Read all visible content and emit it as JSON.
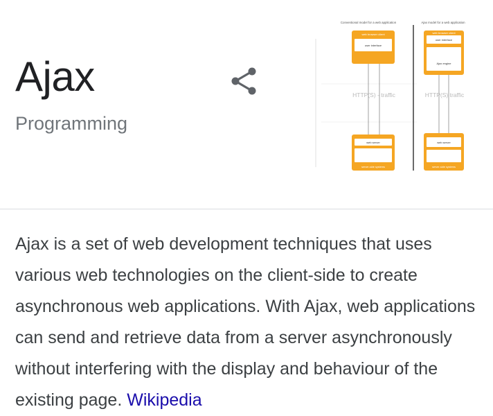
{
  "panel": {
    "title": "Ajax",
    "subtitle": "Programming",
    "description": "Ajax is a set of web development techniques that uses various web technologies on the client-side to create asynchronous web applications. With Ajax, web applications can send and retrieve data from a server asynchronously without interfering with the display and behaviour of the existing page.",
    "source_link": "Wikipedia",
    "share_icon": "share-icon"
  },
  "thumbnail": {
    "left_heading": "Conventional model for a web application",
    "right_heading": "Ajax model for a web application",
    "left_traffic": "HTTP(S) - traffic",
    "right_traffic": "HTTP(S) traffic",
    "browser_client": "web browser client",
    "user_interface": "user interface",
    "ajax_engine": "Ajax engine",
    "web_server": "web server",
    "server_side": "server-side systems",
    "accent": "#f5a623",
    "accent_dark": "#e8941a"
  }
}
